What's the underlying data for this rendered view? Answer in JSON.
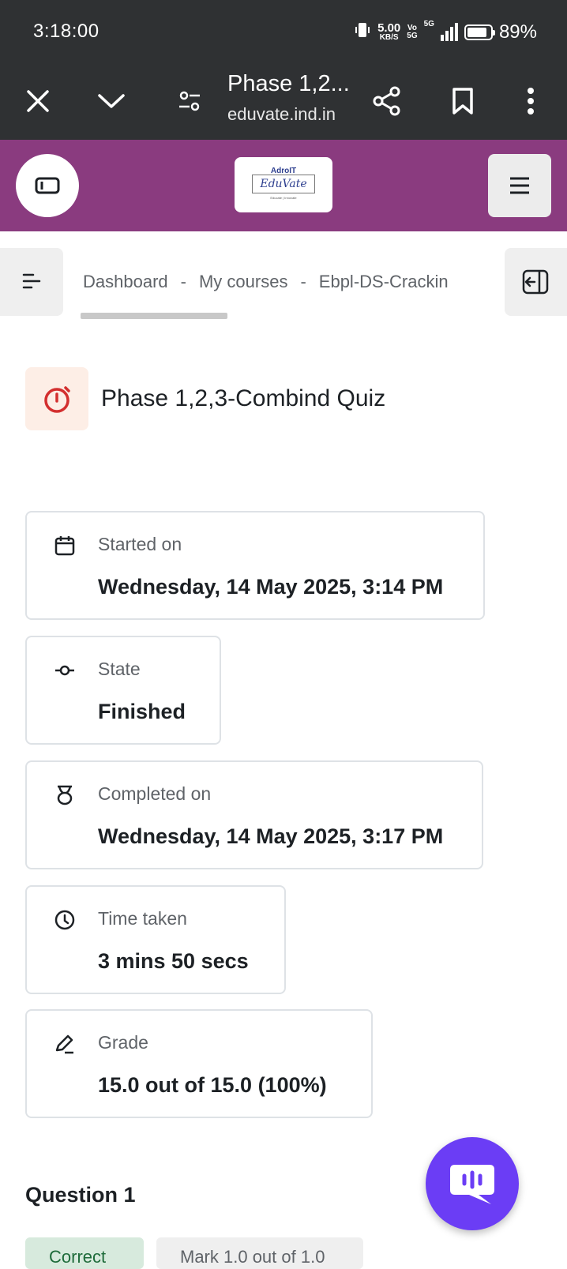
{
  "status_bar": {
    "time": "3:18:00",
    "net_speed_value": "5.00",
    "net_speed_unit": "KB/S",
    "volte_top": "Vo",
    "volte_bottom": "5G",
    "network": "5G",
    "battery": "89%"
  },
  "browser": {
    "title": "Phase 1,2...",
    "url": "eduvate.ind.in"
  },
  "site": {
    "brand_color": "#8a3b7f",
    "logo_top": "AdroIT",
    "logo_main": "EduVate",
    "logo_tagline": "Educate | Innovate"
  },
  "breadcrumb": {
    "items": [
      "Dashboard",
      "My courses",
      "Ebpl-DS-Crackin"
    ],
    "separator": "-"
  },
  "page": {
    "title": "Phase 1,2,3-Combind Quiz"
  },
  "summary": {
    "started": {
      "label": "Started on",
      "value": "Wednesday, 14 May 2025, 3:14 PM"
    },
    "state": {
      "label": "State",
      "value": "Finished"
    },
    "completed": {
      "label": "Completed on",
      "value": "Wednesday, 14 May 2025, 3:17 PM"
    },
    "time_taken": {
      "label": "Time taken",
      "value": "3 mins 50 secs"
    },
    "grade": {
      "label": "Grade",
      "value": "15.0 out of 15.0 (100%)"
    }
  },
  "question": {
    "title": "Question 1",
    "status": "Correct",
    "mark": "Mark 1.0 out of 1.0"
  },
  "icons": {
    "close": "close-icon",
    "minimize": "chevron-down-icon",
    "page_settings": "tune-icon",
    "share": "share-icon",
    "bookmark": "bookmark-icon",
    "more": "more-vertical-icon",
    "drawer": "drawer-toggle-icon",
    "menu": "hamburger-icon",
    "course_index": "course-index-icon",
    "block_drawer": "block-drawer-icon",
    "quiz": "stopwatch-icon",
    "chat": "chat-bubble-icon"
  }
}
